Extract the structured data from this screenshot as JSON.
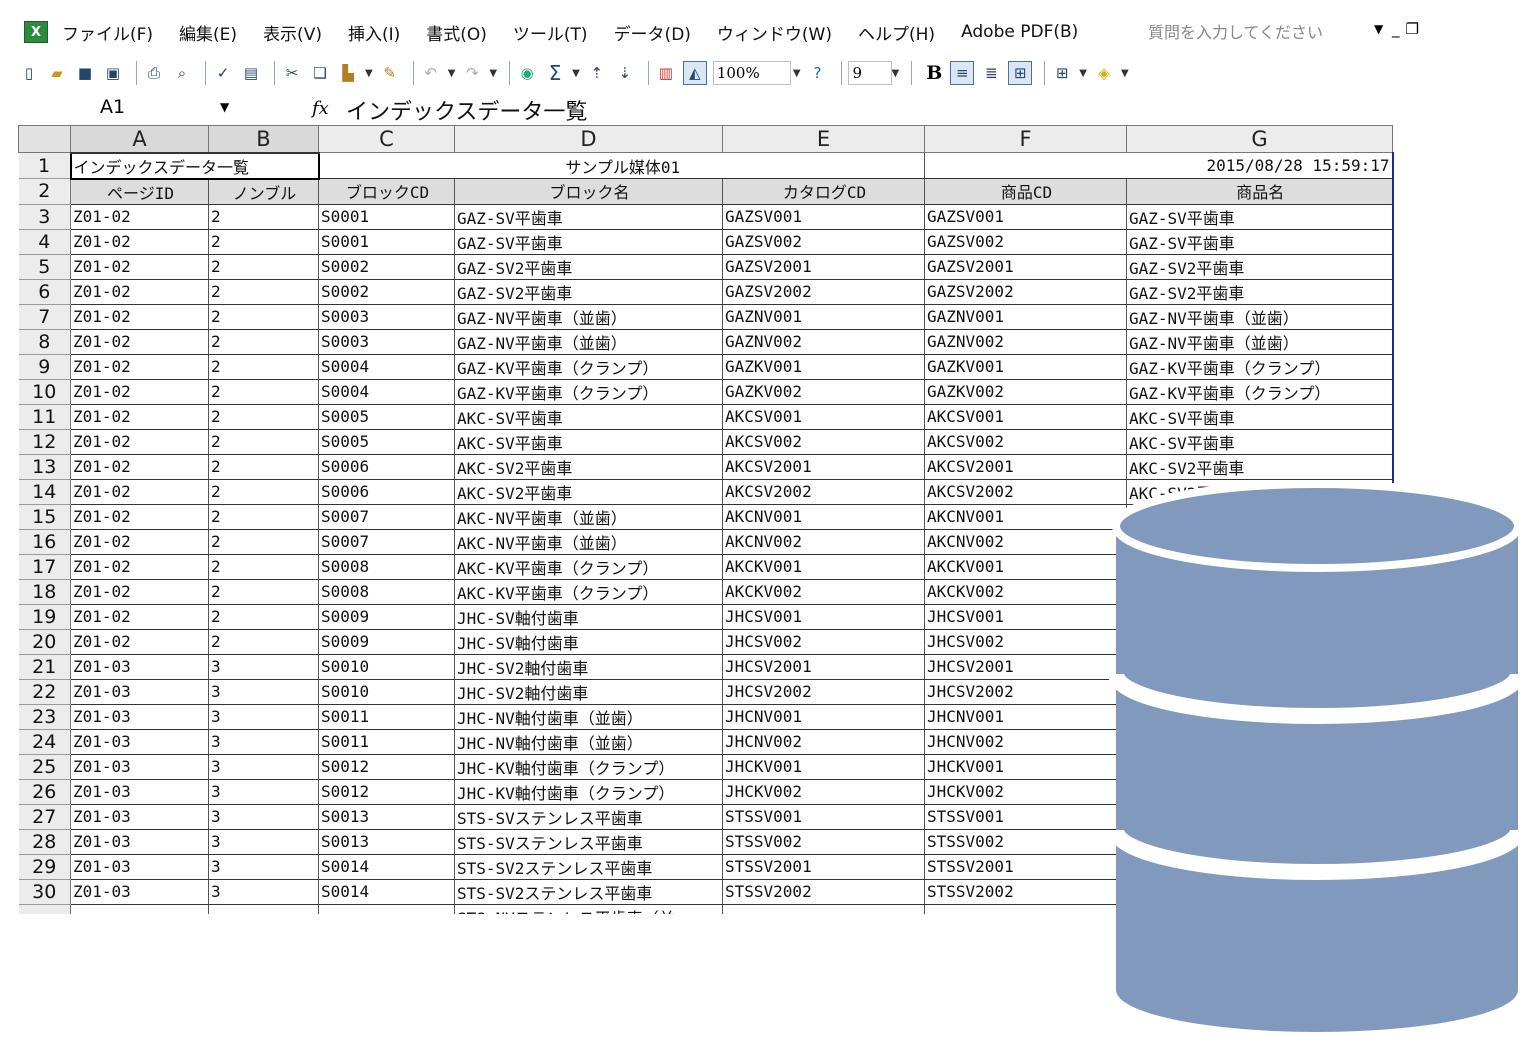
{
  "menu": {
    "items": [
      "ファイル(F)",
      "編集(E)",
      "表示(V)",
      "挿入(I)",
      "書式(O)",
      "ツール(T)",
      "データ(D)",
      "ウィンドウ(W)",
      "ヘルプ(H)",
      "Adobe PDF(B)"
    ],
    "help_placeholder": "質問を入力してください"
  },
  "toolbar": {
    "zoom": "100%",
    "font_size": "9",
    "bold_label": "B",
    "icons": [
      "new-icon",
      "open-icon",
      "save-icon",
      "permission-icon",
      "print-icon",
      "print-preview-icon",
      "spelling-icon",
      "research-icon",
      "cut-icon",
      "copy-icon",
      "paste-icon",
      "format-painter-icon",
      "undo-icon",
      "redo-icon",
      "hyperlink-icon",
      "autosum-icon",
      "sort-ascending-icon",
      "sort-descending-icon",
      "chart-wizard-icon",
      "drawing-icon",
      "help-icon",
      "align-left-icon",
      "center-icon",
      "merge-center-icon",
      "borders-icon",
      "fill-color-icon"
    ]
  },
  "formula_bar": {
    "cell_ref": "A1",
    "fx": "fx",
    "content": "インデックスデータ一覧"
  },
  "grid": {
    "columns": [
      "A",
      "B",
      "C",
      "D",
      "E",
      "F",
      "G"
    ],
    "title_row": {
      "row_no": "1",
      "title": "インデックスデータ一覧",
      "media": "サンプル媒体01",
      "datetime": "2015/08/28 15:59:17"
    },
    "header_row": {
      "row_no": "2",
      "labels": [
        "ページID",
        "ノンブル",
        "ブロックCD",
        "ブロック名",
        "カタログCD",
        "商品CD",
        "商品名"
      ]
    },
    "rows": [
      {
        "n": "3",
        "page": "Z01-02",
        "nombre": "2",
        "block_cd": "S0001",
        "block_name": "GAZ-SV平歯車",
        "catalog": "GAZSV001",
        "product_cd": "GAZSV001",
        "product_name": "GAZ-SV平歯車"
      },
      {
        "n": "4",
        "page": "Z01-02",
        "nombre": "2",
        "block_cd": "S0001",
        "block_name": "GAZ-SV平歯車",
        "catalog": "GAZSV002",
        "product_cd": "GAZSV002",
        "product_name": "GAZ-SV平歯車"
      },
      {
        "n": "5",
        "page": "Z01-02",
        "nombre": "2",
        "block_cd": "S0002",
        "block_name": "GAZ-SV2平歯車",
        "catalog": "GAZSV2001",
        "product_cd": "GAZSV2001",
        "product_name": "GAZ-SV2平歯車"
      },
      {
        "n": "6",
        "page": "Z01-02",
        "nombre": "2",
        "block_cd": "S0002",
        "block_name": "GAZ-SV2平歯車",
        "catalog": "GAZSV2002",
        "product_cd": "GAZSV2002",
        "product_name": "GAZ-SV2平歯車"
      },
      {
        "n": "7",
        "page": "Z01-02",
        "nombre": "2",
        "block_cd": "S0003",
        "block_name": "GAZ-NV平歯車（並歯）",
        "catalog": "GAZNV001",
        "product_cd": "GAZNV001",
        "product_name": "GAZ-NV平歯車（並歯）"
      },
      {
        "n": "8",
        "page": "Z01-02",
        "nombre": "2",
        "block_cd": "S0003",
        "block_name": "GAZ-NV平歯車（並歯）",
        "catalog": "GAZNV002",
        "product_cd": "GAZNV002",
        "product_name": "GAZ-NV平歯車（並歯）"
      },
      {
        "n": "9",
        "page": "Z01-02",
        "nombre": "2",
        "block_cd": "S0004",
        "block_name": "GAZ-KV平歯車（クランプ）",
        "catalog": "GAZKV001",
        "product_cd": "GAZKV001",
        "product_name": "GAZ-KV平歯車（クランプ）"
      },
      {
        "n": "10",
        "page": "Z01-02",
        "nombre": "2",
        "block_cd": "S0004",
        "block_name": "GAZ-KV平歯車（クランプ）",
        "catalog": "GAZKV002",
        "product_cd": "GAZKV002",
        "product_name": "GAZ-KV平歯車（クランプ）"
      },
      {
        "n": "11",
        "page": "Z01-02",
        "nombre": "2",
        "block_cd": "S0005",
        "block_name": "AKC-SV平歯車",
        "catalog": "AKCSV001",
        "product_cd": "AKCSV001",
        "product_name": "AKC-SV平歯車"
      },
      {
        "n": "12",
        "page": "Z01-02",
        "nombre": "2",
        "block_cd": "S0005",
        "block_name": "AKC-SV平歯車",
        "catalog": "AKCSV002",
        "product_cd": "AKCSV002",
        "product_name": "AKC-SV平歯車"
      },
      {
        "n": "13",
        "page": "Z01-02",
        "nombre": "2",
        "block_cd": "S0006",
        "block_name": "AKC-SV2平歯車",
        "catalog": "AKCSV2001",
        "product_cd": "AKCSV2001",
        "product_name": "AKC-SV2平歯車"
      },
      {
        "n": "14",
        "page": "Z01-02",
        "nombre": "2",
        "block_cd": "S0006",
        "block_name": "AKC-SV2平歯車",
        "catalog": "AKCSV2002",
        "product_cd": "AKCSV2002",
        "product_name": "AKC-SV2平歯車"
      },
      {
        "n": "15",
        "page": "Z01-02",
        "nombre": "2",
        "block_cd": "S0007",
        "block_name": "AKC-NV平歯車（並歯）",
        "catalog": "AKCNV001",
        "product_cd": "AKCNV001",
        "product_name": ""
      },
      {
        "n": "16",
        "page": "Z01-02",
        "nombre": "2",
        "block_cd": "S0007",
        "block_name": "AKC-NV平歯車（並歯）",
        "catalog": "AKCNV002",
        "product_cd": "AKCNV002",
        "product_name": ""
      },
      {
        "n": "17",
        "page": "Z01-02",
        "nombre": "2",
        "block_cd": "S0008",
        "block_name": "AKC-KV平歯車（クランプ）",
        "catalog": "AKCKV001",
        "product_cd": "AKCKV001",
        "product_name": ""
      },
      {
        "n": "18",
        "page": "Z01-02",
        "nombre": "2",
        "block_cd": "S0008",
        "block_name": "AKC-KV平歯車（クランプ）",
        "catalog": "AKCKV002",
        "product_cd": "AKCKV002",
        "product_name": ""
      },
      {
        "n": "19",
        "page": "Z01-02",
        "nombre": "2",
        "block_cd": "S0009",
        "block_name": "JHC-SV軸付歯車",
        "catalog": "JHCSV001",
        "product_cd": "JHCSV001",
        "product_name": ""
      },
      {
        "n": "20",
        "page": "Z01-02",
        "nombre": "2",
        "block_cd": "S0009",
        "block_name": "JHC-SV軸付歯車",
        "catalog": "JHCSV002",
        "product_cd": "JHCSV002",
        "product_name": ""
      },
      {
        "n": "21",
        "page": "Z01-03",
        "nombre": "3",
        "block_cd": "S0010",
        "block_name": "JHC-SV2軸付歯車",
        "catalog": "JHCSV2001",
        "product_cd": "JHCSV2001",
        "product_name": ""
      },
      {
        "n": "22",
        "page": "Z01-03",
        "nombre": "3",
        "block_cd": "S0010",
        "block_name": "JHC-SV2軸付歯車",
        "catalog": "JHCSV2002",
        "product_cd": "JHCSV2002",
        "product_name": ""
      },
      {
        "n": "23",
        "page": "Z01-03",
        "nombre": "3",
        "block_cd": "S0011",
        "block_name": "JHC-NV軸付歯車（並歯）",
        "catalog": "JHCNV001",
        "product_cd": "JHCNV001",
        "product_name": ""
      },
      {
        "n": "24",
        "page": "Z01-03",
        "nombre": "3",
        "block_cd": "S0011",
        "block_name": "JHC-NV軸付歯車（並歯）",
        "catalog": "JHCNV002",
        "product_cd": "JHCNV002",
        "product_name": ""
      },
      {
        "n": "25",
        "page": "Z01-03",
        "nombre": "3",
        "block_cd": "S0012",
        "block_name": "JHC-KV軸付歯車（クランプ）",
        "catalog": "JHCKV001",
        "product_cd": "JHCKV001",
        "product_name": ""
      },
      {
        "n": "26",
        "page": "Z01-03",
        "nombre": "3",
        "block_cd": "S0012",
        "block_name": "JHC-KV軸付歯車（クランプ）",
        "catalog": "JHCKV002",
        "product_cd": "JHCKV002",
        "product_name": ""
      },
      {
        "n": "27",
        "page": "Z01-03",
        "nombre": "3",
        "block_cd": "S0013",
        "block_name": "STS-SVステンレス平歯車",
        "catalog": "STSSV001",
        "product_cd": "STSSV001",
        "product_name": ""
      },
      {
        "n": "28",
        "page": "Z01-03",
        "nombre": "3",
        "block_cd": "S0013",
        "block_name": "STS-SVステンレス平歯車",
        "catalog": "STSSV002",
        "product_cd": "STSSV002",
        "product_name": ""
      },
      {
        "n": "29",
        "page": "Z01-03",
        "nombre": "3",
        "block_cd": "S0014",
        "block_name": "STS-SV2ステンレス平歯車",
        "catalog": "STSSV2001",
        "product_cd": "STSSV2001",
        "product_name": ""
      },
      {
        "n": "30",
        "page": "Z01-03",
        "nombre": "3",
        "block_cd": "S0014",
        "block_name": "STS-SV2ステンレス平歯車",
        "catalog": "STSSV2002",
        "product_cd": "STSSV2002",
        "product_name": ""
      },
      {
        "n": "",
        "page": "",
        "nombre": "",
        "block_cd": "",
        "block_name": "STS-NVステンレス平歯車（並",
        "catalog": "",
        "product_cd": "",
        "product_name": ""
      }
    ]
  },
  "overlay": {
    "icon": "database-icon",
    "fill_color": "#8099bd",
    "gap_color": "#ffffff"
  }
}
